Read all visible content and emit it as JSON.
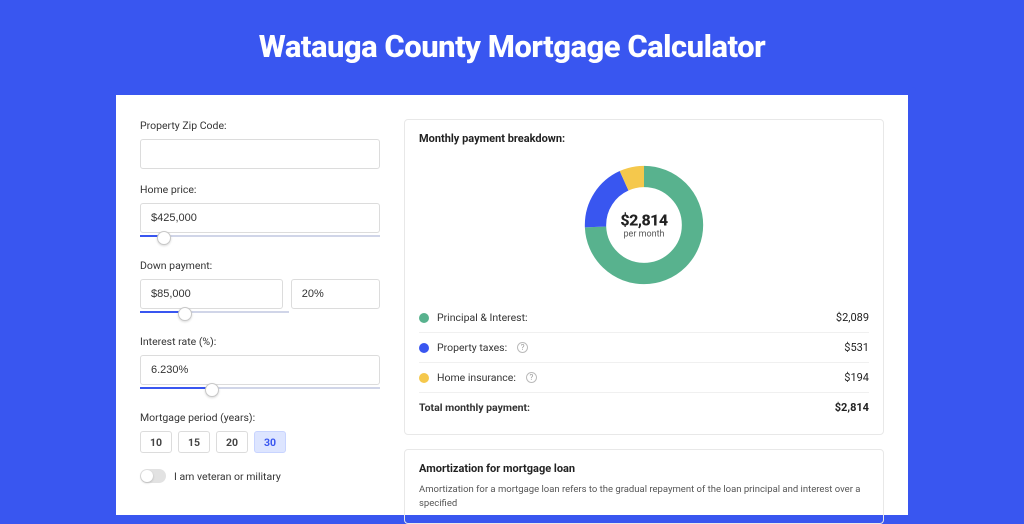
{
  "title": "Watauga County Mortgage Calculator",
  "form": {
    "zip_label": "Property Zip Code:",
    "zip_value": "",
    "home_price_label": "Home price:",
    "home_price_value": "$425,000",
    "home_price_slider_pct": 10,
    "down_label": "Down payment:",
    "down_value": "$85,000",
    "down_pct_value": "20%",
    "down_slider_pct": 30,
    "rate_label": "Interest rate (%):",
    "rate_value": "6.230%",
    "rate_slider_pct": 30,
    "period_label": "Mortgage period (years):",
    "period_options": [
      "10",
      "15",
      "20",
      "30"
    ],
    "period_selected": "30",
    "veteran_label": "I am veteran or military",
    "veteran_checked": false
  },
  "breakdown": {
    "title": "Monthly payment breakdown:",
    "center_amount": "$2,814",
    "center_sub": "per month",
    "items": [
      {
        "label": "Principal & Interest:",
        "value": "$2,089",
        "value_num": 2089,
        "color": "#58b28e",
        "has_info": false
      },
      {
        "label": "Property taxes:",
        "value": "$531",
        "value_num": 531,
        "color": "#3956f0",
        "has_info": true
      },
      {
        "label": "Home insurance:",
        "value": "$194",
        "value_num": 194,
        "color": "#f5c84c",
        "has_info": true
      }
    ],
    "total_label": "Total monthly payment:",
    "total_value": "$2,814"
  },
  "chart_data": {
    "type": "pie",
    "title": "Monthly payment breakdown",
    "series": [
      {
        "name": "Principal & Interest",
        "value": 2089,
        "color": "#58b28e"
      },
      {
        "name": "Property taxes",
        "value": 531,
        "color": "#3956f0"
      },
      {
        "name": "Home insurance",
        "value": 194,
        "color": "#f5c84c"
      }
    ],
    "center_label": "$2,814 per month",
    "total": 2814
  },
  "amortization": {
    "title": "Amortization for mortgage loan",
    "body": "Amortization for a mortgage loan refers to the gradual repayment of the loan principal and interest over a specified"
  }
}
